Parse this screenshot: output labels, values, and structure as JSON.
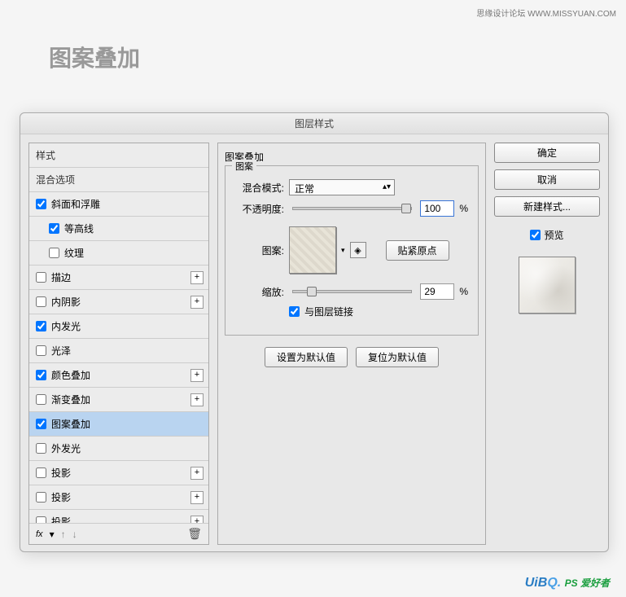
{
  "branding": {
    "top_caption": "思缘设计论坛  WWW.MISSYUAN.COM",
    "watermark_prefix": "UiB",
    "watermark_suffix": "Q.",
    "watermark_tag": "PS 爱好者"
  },
  "header": {
    "title": "图案叠加"
  },
  "dialog": {
    "title": "图层样式"
  },
  "styles": {
    "items": [
      {
        "label": "样式",
        "checked": null,
        "plus": false,
        "indent": false
      },
      {
        "label": "混合选项",
        "checked": null,
        "plus": false,
        "indent": false
      },
      {
        "label": "斜面和浮雕",
        "checked": true,
        "plus": false,
        "indent": false
      },
      {
        "label": "等高线",
        "checked": true,
        "plus": false,
        "indent": true
      },
      {
        "label": "纹理",
        "checked": false,
        "plus": false,
        "indent": true
      },
      {
        "label": "描边",
        "checked": false,
        "plus": true,
        "indent": false
      },
      {
        "label": "内阴影",
        "checked": false,
        "plus": true,
        "indent": false
      },
      {
        "label": "内发光",
        "checked": true,
        "plus": false,
        "indent": false
      },
      {
        "label": "光泽",
        "checked": false,
        "plus": false,
        "indent": false
      },
      {
        "label": "颜色叠加",
        "checked": true,
        "plus": true,
        "indent": false
      },
      {
        "label": "渐变叠加",
        "checked": false,
        "plus": true,
        "indent": false
      },
      {
        "label": "图案叠加",
        "checked": true,
        "plus": false,
        "indent": false,
        "selected": true
      },
      {
        "label": "外发光",
        "checked": false,
        "plus": false,
        "indent": false
      },
      {
        "label": "投影",
        "checked": false,
        "plus": true,
        "indent": false
      },
      {
        "label": "投影",
        "checked": false,
        "plus": true,
        "indent": false
      },
      {
        "label": "投影",
        "checked": false,
        "plus": true,
        "indent": false
      }
    ],
    "footer": {
      "fx_label": "fx",
      "plus": "+"
    }
  },
  "settings": {
    "section_title": "图案叠加",
    "group_legend": "图案",
    "blend_label": "混合模式:",
    "blend_value": "正常",
    "opacity_label": "不透明度:",
    "opacity_value": "100",
    "pattern_label": "图案:",
    "snap_label": "贴紧原点",
    "scale_label": "缩放:",
    "scale_value": "29",
    "percent": "%",
    "link_label": "与图层链接",
    "link_checked": true,
    "set_default": "设置为默认值",
    "reset_default": "复位为默认值"
  },
  "right": {
    "ok": "确定",
    "cancel": "取消",
    "new_style": "新建样式...",
    "preview_label": "预览",
    "preview_checked": true
  }
}
